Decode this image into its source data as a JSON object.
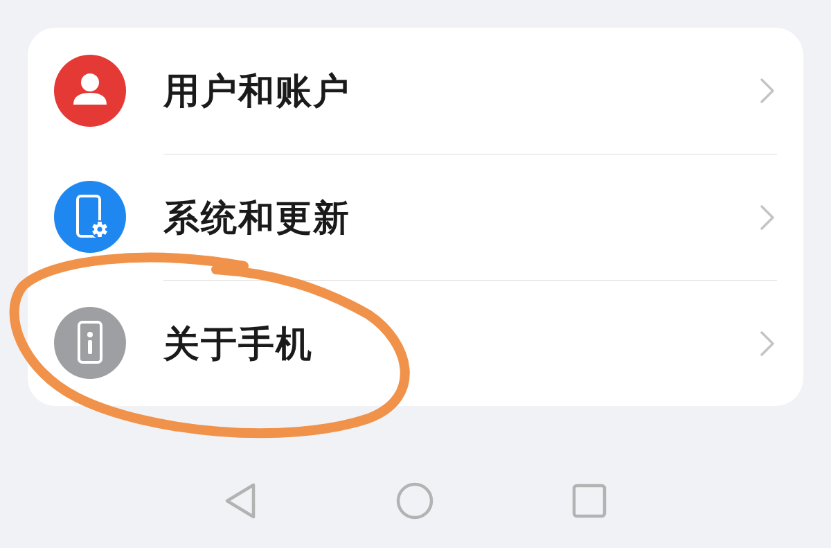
{
  "settings_items": [
    {
      "kind": "user",
      "color": "#e53935",
      "label": "用户和账户",
      "highlighted": false
    },
    {
      "kind": "system",
      "color": "#1f88f0",
      "label": "系统和更新",
      "highlighted": false
    },
    {
      "kind": "info",
      "color": "#9e9fa3",
      "label": "关于手机",
      "highlighted": true
    }
  ]
}
